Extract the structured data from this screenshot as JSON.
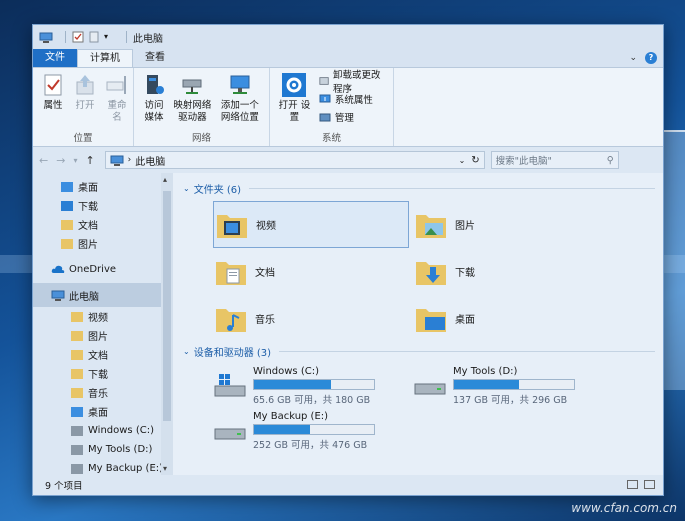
{
  "window": {
    "title": "此电脑",
    "quick_access": [
      "properties",
      "new-folder",
      "dropdown"
    ]
  },
  "tabs": [
    {
      "label": "文件"
    },
    {
      "label": "计算机"
    },
    {
      "label": "查看"
    }
  ],
  "ribbon": {
    "groups": [
      {
        "label": "位置",
        "buttons": [
          {
            "label": "属性",
            "icon": "properties-check-icon"
          },
          {
            "label": "打开",
            "icon": "open-arrow-icon"
          },
          {
            "label": "重命名",
            "icon": "rename-icon"
          }
        ]
      },
      {
        "label": "网络",
        "buttons": [
          {
            "label": "访问媒体",
            "icon": "media-server-icon"
          },
          {
            "label": "映射网络 驱动器",
            "icon": "map-drive-icon"
          },
          {
            "label": "添加一个 网络位置",
            "icon": "network-location-icon"
          }
        ]
      },
      {
        "label": "系统",
        "buttons": [
          {
            "label": "打开 设置",
            "icon": "settings-gear-icon"
          }
        ],
        "small_buttons": [
          {
            "label": "卸载或更改程序",
            "icon": "uninstall-icon"
          },
          {
            "label": "系统属性",
            "icon": "system-properties-icon"
          },
          {
            "label": "管理",
            "icon": "manage-icon"
          }
        ]
      }
    ]
  },
  "address": {
    "path": "此电脑",
    "search_placeholder": "搜索\"此电脑\""
  },
  "sidebar": {
    "quick_access": [
      {
        "label": "桌面",
        "pinned": true
      },
      {
        "label": "下载",
        "pinned": true
      },
      {
        "label": "文档",
        "pinned": true
      },
      {
        "label": "图片",
        "pinned": true
      }
    ],
    "onedrive": "OneDrive",
    "this_pc": "此电脑",
    "pc_children": [
      {
        "label": "视频"
      },
      {
        "label": "图片"
      },
      {
        "label": "文档"
      },
      {
        "label": "下载"
      },
      {
        "label": "音乐"
      },
      {
        "label": "桌面"
      },
      {
        "label": "Windows (C:)"
      },
      {
        "label": "My Tools (D:)"
      },
      {
        "label": "My Backup (E:)"
      }
    ]
  },
  "content": {
    "folders_header": "文件夹 (6)",
    "folders": [
      {
        "label": "视频",
        "icon": "video-folder-icon"
      },
      {
        "label": "图片",
        "icon": "pictures-folder-icon"
      },
      {
        "label": "文档",
        "icon": "documents-folder-icon"
      },
      {
        "label": "下载",
        "icon": "downloads-folder-icon"
      },
      {
        "label": "音乐",
        "icon": "music-folder-icon"
      },
      {
        "label": "桌面",
        "icon": "desktop-folder-icon"
      }
    ],
    "drives_header": "设备和驱动器 (3)",
    "drives": [
      {
        "name": "Windows (C:)",
        "free": "65.6 GB 可用，共 180 GB",
        "used_fraction": 0.64,
        "icon": "windows-drive-icon"
      },
      {
        "name": "My Tools (D:)",
        "free": "137 GB 可用，共 296 GB",
        "used_fraction": 0.54,
        "icon": "drive-icon"
      },
      {
        "name": "My Backup (E:)",
        "free": "252 GB 可用，共 476 GB",
        "used_fraction": 0.47,
        "icon": "drive-icon"
      }
    ]
  },
  "status": {
    "count": "9 个项目"
  },
  "watermark": "www.cfan.com.cn",
  "colors": {
    "accent": "#1f6fc6",
    "bar_fill": "#2b8ad8",
    "section_header": "#1d5ea8"
  }
}
